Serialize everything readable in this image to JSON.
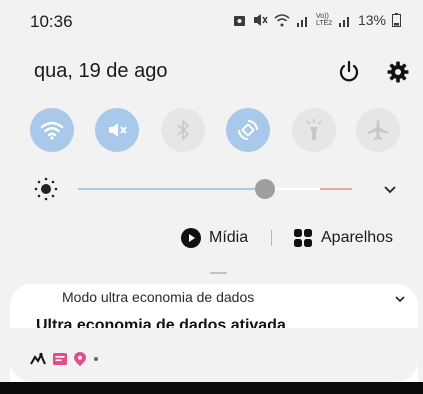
{
  "status_bar": {
    "time": "10:36",
    "volte_label": "Vo)) LTE2",
    "battery_percent": "13%",
    "icons": [
      "photo-icon",
      "mute-icon",
      "wifi-signal-icon",
      "signal-icon",
      "signal-icon",
      "battery-icon"
    ]
  },
  "header": {
    "date": "qua, 19 de ago",
    "power_icon": "power-icon",
    "settings_icon": "gear-icon"
  },
  "quick_settings": {
    "tiles": [
      {
        "icon": "wifi-icon",
        "state": "on"
      },
      {
        "icon": "sound-off-icon",
        "state": "on"
      },
      {
        "icon": "bluetooth-icon",
        "state": "off"
      },
      {
        "icon": "auto-rotate-icon",
        "state": "on"
      },
      {
        "icon": "flashlight-icon",
        "state": "off"
      },
      {
        "icon": "airplane-icon",
        "state": "off"
      }
    ]
  },
  "brightness": {
    "level": 0.68
  },
  "media_row": {
    "media_label": "Mídia",
    "devices_label": "Aparelhos"
  },
  "notification": {
    "header": "Modo ultra economia de dados",
    "title": "Ultra economia de dados ativada"
  },
  "colors": {
    "tile_on": "#a9c9ea",
    "tile_off": "#e6e6e6",
    "panel_bg": "#f2f2f2",
    "accent_pink": "#e44d87"
  }
}
